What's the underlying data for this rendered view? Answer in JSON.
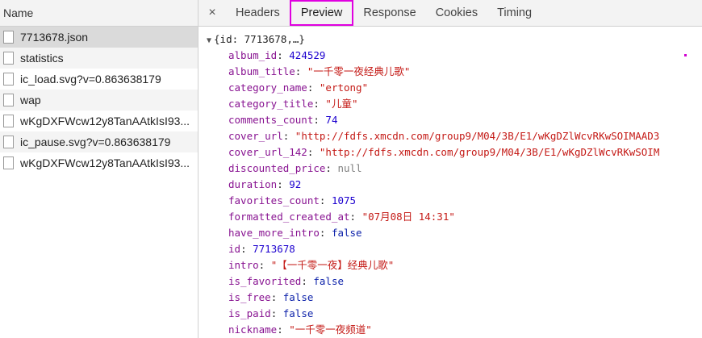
{
  "left_panel": {
    "header": "Name",
    "files": [
      {
        "name": "7713678.json",
        "selected": true
      },
      {
        "name": "statistics",
        "selected": false
      },
      {
        "name": "ic_load.svg?v=0.863638179",
        "selected": false
      },
      {
        "name": "wap",
        "selected": false
      },
      {
        "name": "wKgDXFWcw12y8TanAAtkIsI93...",
        "selected": false
      },
      {
        "name": "ic_pause.svg?v=0.863638179",
        "selected": false
      },
      {
        "name": "wKgDXFWcw12y8TanAAtkIsI93...",
        "selected": false
      }
    ]
  },
  "tabs": {
    "close_symbol": "×",
    "items": [
      "Headers",
      "Preview",
      "Response",
      "Cookies",
      "Timing"
    ],
    "active": "Preview"
  },
  "preview": {
    "root_caret": "▼",
    "root": "{id: 7713678,…}",
    "properties": [
      {
        "key": "album_id",
        "value": "424529",
        "type": "number"
      },
      {
        "key": "album_title",
        "value": "\"一千零一夜经典儿歌\"",
        "type": "string"
      },
      {
        "key": "category_name",
        "value": "\"ertong\"",
        "type": "string"
      },
      {
        "key": "category_title",
        "value": "\"儿童\"",
        "type": "string"
      },
      {
        "key": "comments_count",
        "value": "74",
        "type": "number"
      },
      {
        "key": "cover_url",
        "value": "\"http://fdfs.xmcdn.com/group9/M04/3B/E1/wKgDZlWcvRKwSOIMAAD3",
        "type": "string"
      },
      {
        "key": "cover_url_142",
        "value": "\"http://fdfs.xmcdn.com/group9/M04/3B/E1/wKgDZlWcvRKwSOIM",
        "type": "string"
      },
      {
        "key": "discounted_price",
        "value": "null",
        "type": "null"
      },
      {
        "key": "duration",
        "value": "92",
        "type": "number"
      },
      {
        "key": "favorites_count",
        "value": "1075",
        "type": "number"
      },
      {
        "key": "formatted_created_at",
        "value": "\"07月08日 14:31\"",
        "type": "string"
      },
      {
        "key": "have_more_intro",
        "value": "false",
        "type": "bool"
      },
      {
        "key": "id",
        "value": "7713678",
        "type": "number"
      },
      {
        "key": "intro",
        "value": "\"【一千零一夜】经典儿歌\"",
        "type": "string"
      },
      {
        "key": "is_favorited",
        "value": "false",
        "type": "bool"
      },
      {
        "key": "is_free",
        "value": "false",
        "type": "bool"
      },
      {
        "key": "is_paid",
        "value": "false",
        "type": "bool"
      },
      {
        "key": "nickname",
        "value": "\"一千零一夜频道\"",
        "type": "string"
      }
    ]
  },
  "colors": {
    "key": "#881391",
    "string": "#c41a16",
    "number": "#1c00cf",
    "highlight": "#e000e0"
  }
}
